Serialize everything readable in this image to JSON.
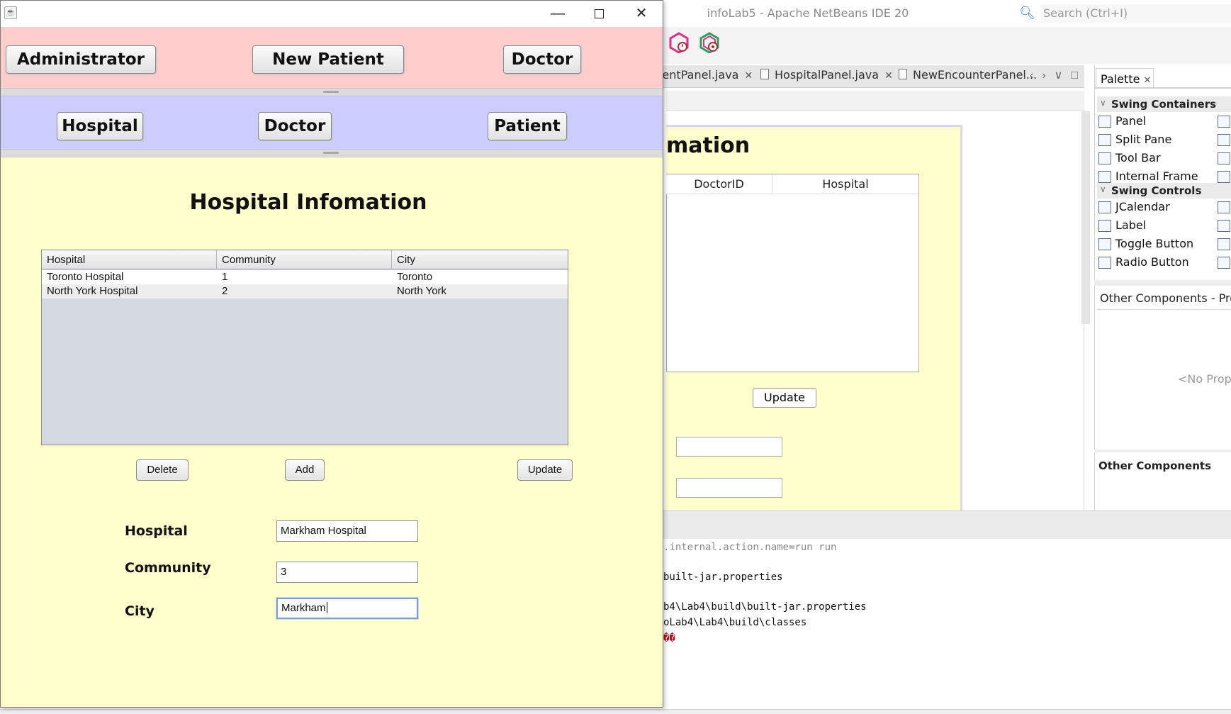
{
  "netbeans": {
    "window_title": "infoLab5 - Apache NetBeans IDE 20",
    "search_placeholder": "Search (Ctrl+I)",
    "editor_tabs": [
      {
        "label": "ientPanel.java"
      },
      {
        "label": "HospitalPanel.java"
      },
      {
        "label": "NewEncounterPanel..."
      }
    ],
    "design_form": {
      "title_fragment": "mation",
      "table_headers": [
        "DoctorID",
        "Hospital"
      ],
      "update_label": "Update"
    },
    "palette": {
      "tab_label": "Palette",
      "groups": [
        {
          "title": "Swing Containers",
          "items": [
            "Panel",
            "Split Pane",
            "Tool Bar",
            "Internal Frame"
          ]
        },
        {
          "title": "Swing Controls",
          "items": [
            "JCalendar",
            "Label",
            "Toggle Button",
            "Radio Button"
          ]
        }
      ],
      "properties_title": "Other Components - Prop",
      "no_properties": "<No Prop",
      "other_components": "Other Components"
    },
    "output_lines": [
      ".internal.action.name=run run",
      "built-jar.properties",
      "b4\\Lab4\\build\\built-jar.properties",
      "oLab4\\Lab4\\build\\classes",
      "��"
    ]
  },
  "app": {
    "top_buttons": [
      "Administrator",
      "New Patient",
      "Doctor"
    ],
    "mid_buttons": [
      "Hospital",
      "Doctor",
      "Patient"
    ],
    "panel_title": "Hospital Infomation",
    "table": {
      "columns": [
        "Hospital",
        "Community",
        "City"
      ],
      "rows": [
        [
          "Toronto Hospital",
          "1",
          "Toronto"
        ],
        [
          "North York Hospital",
          "2",
          "North York"
        ]
      ]
    },
    "actions": {
      "delete": "Delete",
      "add": "Add",
      "update": "Update"
    },
    "form": {
      "hospital_label": "Hospital",
      "community_label": "Community",
      "city_label": "City",
      "hospital_value": "Markham Hospital",
      "community_value": "3",
      "city_value": "Markham"
    }
  },
  "colors": {
    "top_panel": "#ffcccc",
    "nav_panel": "#ccccff",
    "work_panel": "#ffffcc"
  }
}
